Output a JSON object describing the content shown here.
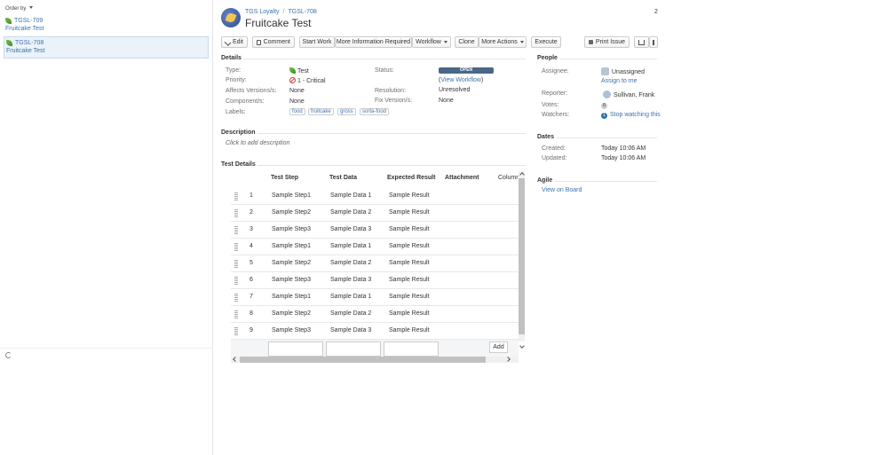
{
  "left": {
    "order_label": "Order by",
    "issues": [
      {
        "key": "TGSL-709",
        "summary": "Fruitcake Test"
      },
      {
        "key": "TGSL-708",
        "summary": "Fruitcake Test"
      }
    ]
  },
  "header": {
    "project": "TGS Loyalty",
    "issue_key": "TGSL-708",
    "title": "Fruitcake Test",
    "counter": "2"
  },
  "toolbar": {
    "edit": "Edit",
    "comment": "Comment",
    "start_work": "Start Work",
    "more_info": "More Information Required",
    "workflow": "Workflow",
    "clone": "Clone",
    "more_actions": "More Actions",
    "execute": "Execute",
    "print": "Print Issue"
  },
  "details": {
    "title": "Details",
    "type_label": "Type:",
    "type_value": "Test",
    "priority_label": "Priority:",
    "priority_value": "1 - Critical",
    "affects_label": "Affects Versions/s:",
    "affects_value": "None",
    "components_label": "Component/s:",
    "components_value": "None",
    "labels_label": "Labels:",
    "labels": [
      "food",
      "fruitcake",
      "gross",
      "sorta-food"
    ],
    "status_label": "Status:",
    "status_value": "OPEN",
    "view_workflow": "View Workflow",
    "resolution_label": "Resolution:",
    "resolution_value": "Unresolved",
    "fix_label": "Fix Version/s:",
    "fix_value": "None"
  },
  "description": {
    "title": "Description",
    "placeholder": "Click to add description"
  },
  "test_details": {
    "title": "Test Details",
    "columns": [
      "Test Step",
      "Test Data",
      "Expected Result",
      "Attachment",
      "Column"
    ],
    "rows": [
      {
        "n": "1",
        "step": "Sample Step1",
        "data": "Sample Data 1",
        "result": "Sample Result"
      },
      {
        "n": "2",
        "step": "Sample Step2",
        "data": "Sample Data 2",
        "result": "Sample Result"
      },
      {
        "n": "3",
        "step": "Sample Step3",
        "data": "Sample Data 3",
        "result": "Sample Result"
      },
      {
        "n": "4",
        "step": "Sample Step1",
        "data": "Sample Data 1",
        "result": "Sample Result"
      },
      {
        "n": "5",
        "step": "Sample Step2",
        "data": "Sample Data 2",
        "result": "Sample Result"
      },
      {
        "n": "6",
        "step": "Sample Step3",
        "data": "Sample Data 3",
        "result": "Sample Result"
      },
      {
        "n": "7",
        "step": "Sample Step1",
        "data": "Sample Data 1",
        "result": "Sample Result"
      },
      {
        "n": "8",
        "step": "Sample Step2",
        "data": "Sample Data 2",
        "result": "Sample Result"
      },
      {
        "n": "9",
        "step": "Sample Step3",
        "data": "Sample Data 3",
        "result": "Sample Result"
      }
    ],
    "add_label": "Add"
  },
  "people": {
    "title": "People",
    "assignee_label": "Assignee:",
    "assignee_value": "Unassigned",
    "assign_to_me": "Assign to me",
    "reporter_label": "Reporter:",
    "reporter_value": "Sullivan, Frank",
    "votes_label": "Votes:",
    "votes_value": "0",
    "watchers_label": "Watchers:",
    "watchers_count": "1",
    "watch_link": "Stop watching this"
  },
  "dates": {
    "title": "Dates",
    "created_label": "Created:",
    "created_value": "Today 10:06 AM",
    "updated_label": "Updated:",
    "updated_value": "Today 10:06 AM"
  },
  "agile": {
    "title": "Agile",
    "view_board": "View on Board"
  }
}
